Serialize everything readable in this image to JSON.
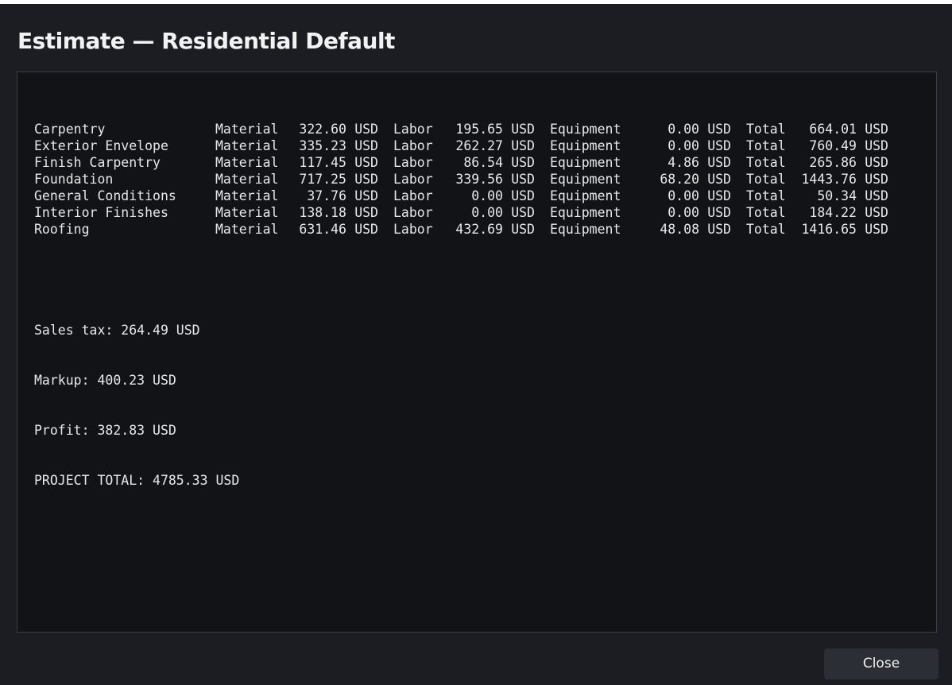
{
  "window": {
    "title": "Estimate — Residential Default"
  },
  "report": {
    "rows": [
      {
        "name": "Carpentry",
        "material_label": "Material",
        "material": "322.60",
        "material_cur": "USD",
        "labor_label": "Labor",
        "labor": "195.65",
        "labor_cur": "USD",
        "equipment_label": "Equipment",
        "equipment": "0.00",
        "equipment_cur": "USD",
        "total_label": "Total",
        "total": "664.01",
        "total_cur": "USD"
      },
      {
        "name": "Exterior Envelope",
        "material_label": "Material",
        "material": "335.23",
        "material_cur": "USD",
        "labor_label": "Labor",
        "labor": "262.27",
        "labor_cur": "USD",
        "equipment_label": "Equipment",
        "equipment": "0.00",
        "equipment_cur": "USD",
        "total_label": "Total",
        "total": "760.49",
        "total_cur": "USD"
      },
      {
        "name": "Finish Carpentry",
        "material_label": "Material",
        "material": "117.45",
        "material_cur": "USD",
        "labor_label": "Labor",
        "labor": "86.54",
        "labor_cur": "USD",
        "equipment_label": "Equipment",
        "equipment": "4.86",
        "equipment_cur": "USD",
        "total_label": "Total",
        "total": "265.86",
        "total_cur": "USD"
      },
      {
        "name": "Foundation",
        "material_label": "Material",
        "material": "717.25",
        "material_cur": "USD",
        "labor_label": "Labor",
        "labor": "339.56",
        "labor_cur": "USD",
        "equipment_label": "Equipment",
        "equipment": "68.20",
        "equipment_cur": "USD",
        "total_label": "Total",
        "total": "1443.76",
        "total_cur": "USD"
      },
      {
        "name": "General Conditions",
        "material_label": "Material",
        "material": "37.76",
        "material_cur": "USD",
        "labor_label": "Labor",
        "labor": "0.00",
        "labor_cur": "USD",
        "equipment_label": "Equipment",
        "equipment": "0.00",
        "equipment_cur": "USD",
        "total_label": "Total",
        "total": "50.34",
        "total_cur": "USD"
      },
      {
        "name": "Interior Finishes",
        "material_label": "Material",
        "material": "138.18",
        "material_cur": "USD",
        "labor_label": "Labor",
        "labor": "0.00",
        "labor_cur": "USD",
        "equipment_label": "Equipment",
        "equipment": "0.00",
        "equipment_cur": "USD",
        "total_label": "Total",
        "total": "184.22",
        "total_cur": "USD"
      },
      {
        "name": "Roofing",
        "material_label": "Material",
        "material": "631.46",
        "material_cur": "USD",
        "labor_label": "Labor",
        "labor": "432.69",
        "labor_cur": "USD",
        "equipment_label": "Equipment",
        "equipment": "48.08",
        "equipment_cur": "USD",
        "total_label": "Total",
        "total": "1416.65",
        "total_cur": "USD"
      }
    ],
    "summary": {
      "sales_tax": "Sales tax: 264.49 USD",
      "markup": "Markup: 400.23 USD",
      "profit": "Profit: 382.83 USD",
      "project_total": "PROJECT TOTAL: 4785.33 USD"
    }
  },
  "footer": {
    "close_label": "Close"
  },
  "colors": {
    "window_bg": "#1c1d22",
    "report_bg": "#121317",
    "text": "#e8e8e8",
    "button_bg": "#2c2e36"
  }
}
